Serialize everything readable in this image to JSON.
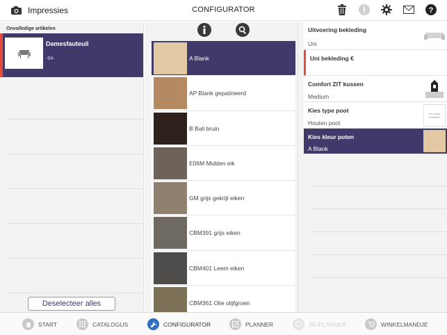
{
  "header": {
    "impressions_label": "Impressies",
    "title": "CONFIGURATOR"
  },
  "left": {
    "section_label": "Onvolledige artikelen",
    "article": {
      "name": "Damesfauteuil",
      "code": "-54-"
    },
    "deselect_label": "Deselecteer alles"
  },
  "middle": {
    "swatches": [
      {
        "label": "A Blank",
        "color": "#e3c9a3",
        "selected": true
      },
      {
        "label": "AP Blank gepatineerd",
        "color": "#b58a62",
        "selected": false
      },
      {
        "label": "B Bali bruin",
        "color": "#2e211c",
        "selected": false
      },
      {
        "label": "E06M Midden eik",
        "color": "#6e6359",
        "selected": false
      },
      {
        "label": "GM grijs gekrijt eiken",
        "color": "#8f8070",
        "selected": false
      },
      {
        "label": "CBM391 grijs eiken",
        "color": "#6f6a61",
        "selected": false
      },
      {
        "label": "CBM401 Leem eiken",
        "color": "#4e4d4b",
        "selected": false
      },
      {
        "label": "CBM361 Olie olijfgroen",
        "color": "#7c7156",
        "selected": false
      }
    ]
  },
  "right": {
    "options": [
      {
        "title": "Uitvoering bekleding",
        "value": "Uni"
      },
      {
        "title": "Uni bekleding €",
        "value": ""
      },
      {
        "title": "Comfort ZIT kussen",
        "value": "Medium"
      },
      {
        "title": "Kies type poot",
        "value": "Houten poot",
        "thumb_text": "No image available"
      },
      {
        "title": "Kies kleur poten",
        "value": "A Blank"
      }
    ]
  },
  "tabs": [
    {
      "label": "START",
      "icon": "home-icon"
    },
    {
      "label": "CATALOGUS",
      "icon": "grid-icon"
    },
    {
      "label": "CONFIGURATOR",
      "icon": "wrench-icon"
    },
    {
      "label": "PLANNER",
      "icon": "planner-icon"
    },
    {
      "label": "3D-PLANNER",
      "icon": "cube-icon"
    },
    {
      "label": "WINKELMANDJE",
      "icon": "cart-icon"
    }
  ],
  "colors": {
    "accent": "#3f3a69",
    "warning": "#e34b3c",
    "active_tab": "#2f6fc4"
  }
}
